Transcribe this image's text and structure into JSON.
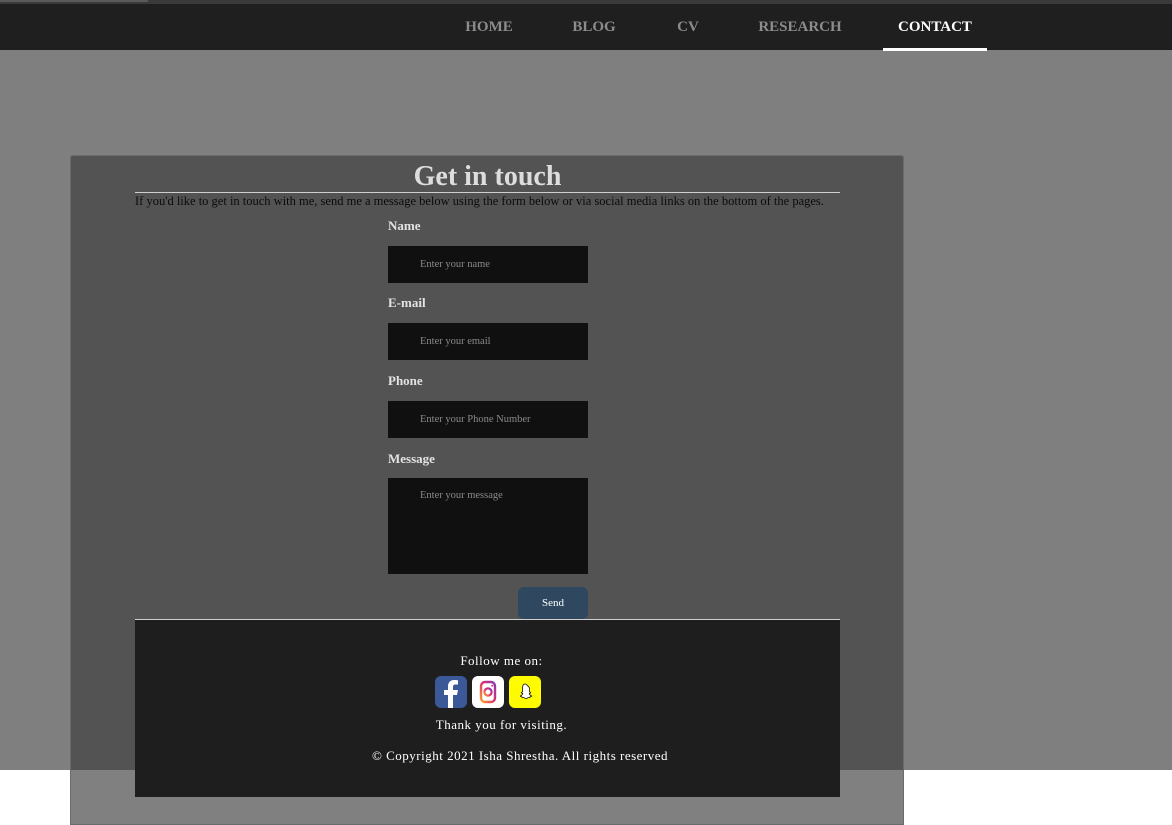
{
  "nav": {
    "items": [
      {
        "label": "HOME"
      },
      {
        "label": "BLOG"
      },
      {
        "label": "CV"
      },
      {
        "label": "RESEARCH"
      },
      {
        "label": "CONTACT",
        "active": true
      }
    ]
  },
  "contact": {
    "title": "Get in touch",
    "intro": "If you'd like to get in touch with me, send me a message below using the form below or via social media links on the bottom of the pages.",
    "fields": {
      "name": {
        "label": "Name",
        "placeholder": "Enter your name",
        "value": ""
      },
      "email": {
        "label": "E-mail",
        "placeholder": "Enter your email",
        "value": ""
      },
      "phone": {
        "label": "Phone",
        "placeholder": "Enter your Phone Number",
        "value": ""
      },
      "message": {
        "label": "Message",
        "placeholder": "Enter your message",
        "value": ""
      }
    },
    "send_label": "Send"
  },
  "footer": {
    "follow": "Follow me on:",
    "social": [
      {
        "icon": "facebook-icon",
        "color": "#3b5998"
      },
      {
        "icon": "instagram-icon",
        "color": "#e1306c"
      },
      {
        "icon": "snapchat-icon",
        "color": "#fffc00"
      }
    ],
    "thanks": "Thank you for visiting.",
    "copyright": "© Copyright 2021 Isha Shrestha. All rights reserved"
  },
  "colors": {
    "navbar": "#1f1f1f",
    "page_bg": "#7f7f7f",
    "card": "#535353",
    "input_bg": "#101010",
    "send_button": "#2f4860",
    "footer": "#1e1e1e"
  }
}
